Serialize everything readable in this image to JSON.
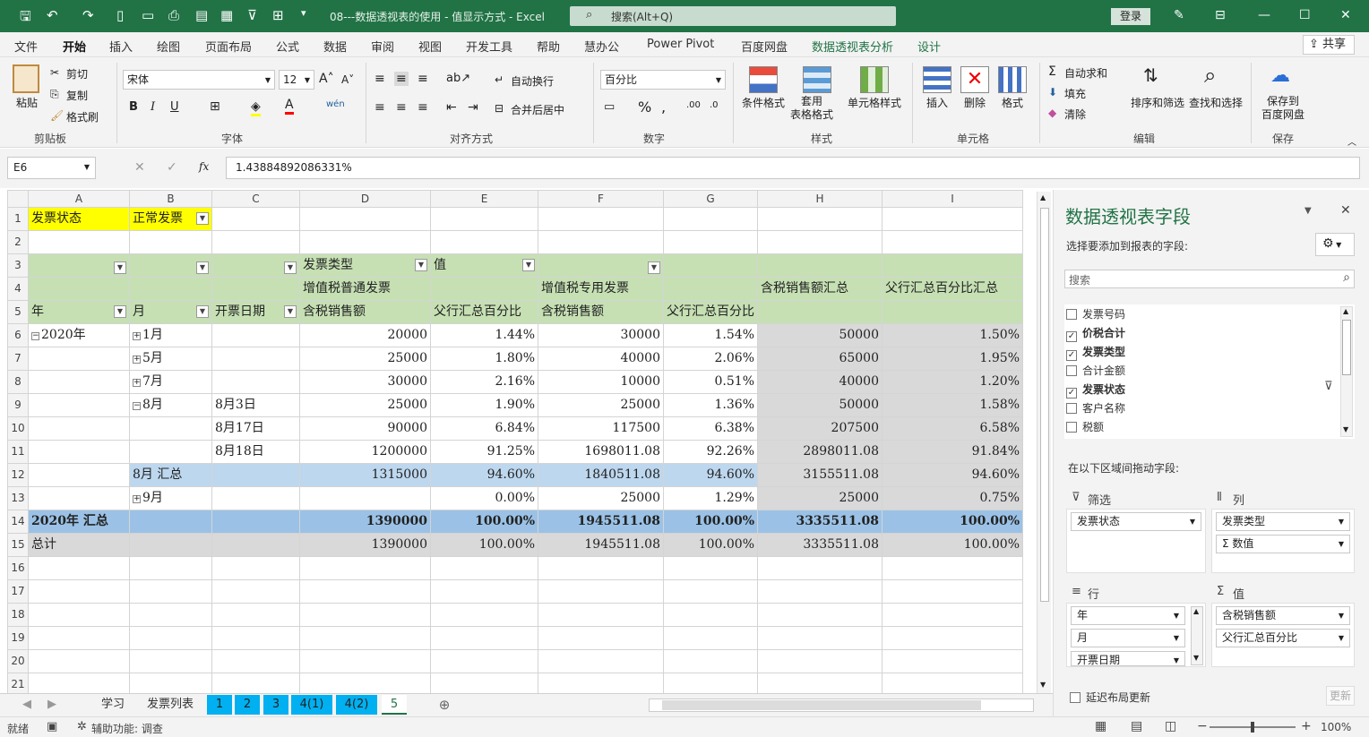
{
  "title_bar": {
    "doc_title": "08---数据透视表的使用 - 值显示方式 - Excel",
    "search_placeholder": "搜索(Alt+Q)",
    "login": "登录"
  },
  "menu_tabs": [
    "文件",
    "开始",
    "插入",
    "绘图",
    "页面布局",
    "公式",
    "数据",
    "审阅",
    "视图",
    "开发工具",
    "帮助",
    "慧办公",
    "Power Pivot",
    "百度网盘",
    "数据透视表分析",
    "设计"
  ],
  "share": "共享",
  "ribbon": {
    "clipboard": {
      "paste": "粘贴",
      "cut": "剪切",
      "copy": "复制",
      "format_painter": "格式刷",
      "label": "剪贴板"
    },
    "font": {
      "name": "宋体",
      "size": "12",
      "bold": "B",
      "italic": "I",
      "underline": "U",
      "label": "字体"
    },
    "alignment": {
      "wrap": "自动换行",
      "merge": "合并后居中",
      "label": "对齐方式"
    },
    "number": {
      "format": "百分比",
      "label": "数字"
    },
    "styles": {
      "conditional": "条件格式",
      "table_format": "套用\n表格格式",
      "cell_styles": "单元格样式",
      "label": "样式"
    },
    "cells": {
      "insert": "插入",
      "delete": "删除",
      "format": "格式",
      "label": "单元格"
    },
    "editing": {
      "autosum": "自动求和",
      "fill": "填充",
      "clear": "清除",
      "sort": "排序和筛选",
      "find": "查找和选择",
      "label": "编辑"
    },
    "save": {
      "save_to": "保存到\n百度网盘",
      "label": "保存"
    }
  },
  "formula_bar": {
    "cell_ref": "E6",
    "value": "1.43884892086331%"
  },
  "columns": [
    "A",
    "B",
    "C",
    "D",
    "E",
    "F",
    "G",
    "H",
    "I"
  ],
  "rows": [
    {
      "n": "1",
      "cells": [
        "发票状态",
        "正常发票",
        "",
        "",
        "",
        "",
        "",
        "",
        ""
      ]
    },
    {
      "n": "2",
      "cells": [
        "",
        "",
        "",
        "",
        "",
        "",
        "",
        "",
        ""
      ]
    },
    {
      "n": "3",
      "cells": [
        "",
        "",
        "",
        "发票类型",
        "值",
        "",
        "",
        "",
        ""
      ]
    },
    {
      "n": "4",
      "cells": [
        "",
        "",
        "",
        "增值税普通发票",
        "",
        "增值税专用发票",
        "",
        "含税销售额汇总",
        "父行汇总百分比汇总"
      ]
    },
    {
      "n": "5",
      "cells": [
        "年",
        "月",
        "开票日期",
        "含税销售额",
        "父行汇总百分比",
        "含税销售额",
        "父行汇总百分比",
        "",
        ""
      ]
    },
    {
      "n": "6",
      "cells": [
        "2020年",
        "1月",
        "",
        "20000",
        "1.44%",
        "30000",
        "1.54%",
        "50000",
        "1.50%"
      ]
    },
    {
      "n": "7",
      "cells": [
        "",
        "5月",
        "",
        "25000",
        "1.80%",
        "40000",
        "2.06%",
        "65000",
        "1.95%"
      ]
    },
    {
      "n": "8",
      "cells": [
        "",
        "7月",
        "",
        "30000",
        "2.16%",
        "10000",
        "0.51%",
        "40000",
        "1.20%"
      ]
    },
    {
      "n": "9",
      "cells": [
        "",
        "8月",
        "8月3日",
        "25000",
        "1.90%",
        "25000",
        "1.36%",
        "50000",
        "1.58%"
      ]
    },
    {
      "n": "10",
      "cells": [
        "",
        "",
        "8月17日",
        "90000",
        "6.84%",
        "117500",
        "6.38%",
        "207500",
        "6.58%"
      ]
    },
    {
      "n": "11",
      "cells": [
        "",
        "",
        "8月18日",
        "1200000",
        "91.25%",
        "1698011.08",
        "92.26%",
        "2898011.08",
        "91.84%"
      ]
    },
    {
      "n": "12",
      "cells": [
        "",
        "8月 汇总",
        "",
        "1315000",
        "94.60%",
        "1840511.08",
        "94.60%",
        "3155511.08",
        "94.60%"
      ]
    },
    {
      "n": "13",
      "cells": [
        "",
        "9月",
        "",
        "",
        "0.00%",
        "25000",
        "1.29%",
        "25000",
        "0.75%"
      ]
    },
    {
      "n": "14",
      "cells": [
        "2020年 汇总",
        "",
        "",
        "1390000",
        "100.00%",
        "1945511.08",
        "100.00%",
        "3335511.08",
        "100.00%"
      ]
    },
    {
      "n": "15",
      "cells": [
        "总计",
        "",
        "",
        "1390000",
        "100.00%",
        "1945511.08",
        "100.00%",
        "3335511.08",
        "100.00%"
      ]
    },
    {
      "n": "16",
      "cells": [
        "",
        "",
        "",
        "",
        "",
        "",
        "",
        "",
        ""
      ]
    },
    {
      "n": "17",
      "cells": [
        "",
        "",
        "",
        "",
        "",
        "",
        "",
        "",
        ""
      ]
    },
    {
      "n": "18",
      "cells": [
        "",
        "",
        "",
        "",
        "",
        "",
        "",
        "",
        ""
      ]
    },
    {
      "n": "19",
      "cells": [
        "",
        "",
        "",
        "",
        "",
        "",
        "",
        "",
        ""
      ]
    },
    {
      "n": "20",
      "cells": [
        "",
        "",
        "",
        "",
        "",
        "",
        "",
        "",
        ""
      ]
    },
    {
      "n": "21",
      "cells": [
        "",
        "",
        "",
        "",
        "",
        "",
        "",
        "",
        ""
      ]
    }
  ],
  "sheet_tabs": [
    "学习",
    "发票列表",
    "1",
    "2",
    "3",
    "4(1)",
    "4(2)",
    "5"
  ],
  "status": {
    "ready": "就绪",
    "accessibility": "辅助功能: 调查",
    "zoom": "100%"
  },
  "pivot_panel": {
    "title": "数据透视表字段",
    "choose_label": "选择要添加到报表的字段:",
    "search_placeholder": "搜索",
    "fields": [
      {
        "name": "发票号码",
        "checked": false
      },
      {
        "name": "价税合计",
        "checked": true
      },
      {
        "name": "发票类型",
        "checked": true
      },
      {
        "name": "合计金额",
        "checked": false
      },
      {
        "name": "发票状态",
        "checked": true
      },
      {
        "name": "客户名称",
        "checked": false
      },
      {
        "name": "税额",
        "checked": false
      }
    ],
    "drag_label": "在以下区域间拖动字段:",
    "filter_title": "筛选",
    "filter_items": [
      "发票状态"
    ],
    "column_title": "列",
    "column_items": [
      "发票类型",
      "Σ 数值"
    ],
    "row_title": "行",
    "row_items": [
      "年",
      "月",
      "开票日期"
    ],
    "value_title": "值",
    "value_items": [
      "含税销售额",
      "父行汇总百分比"
    ],
    "defer_label": "延迟布局更新",
    "update_btn": "更新"
  }
}
